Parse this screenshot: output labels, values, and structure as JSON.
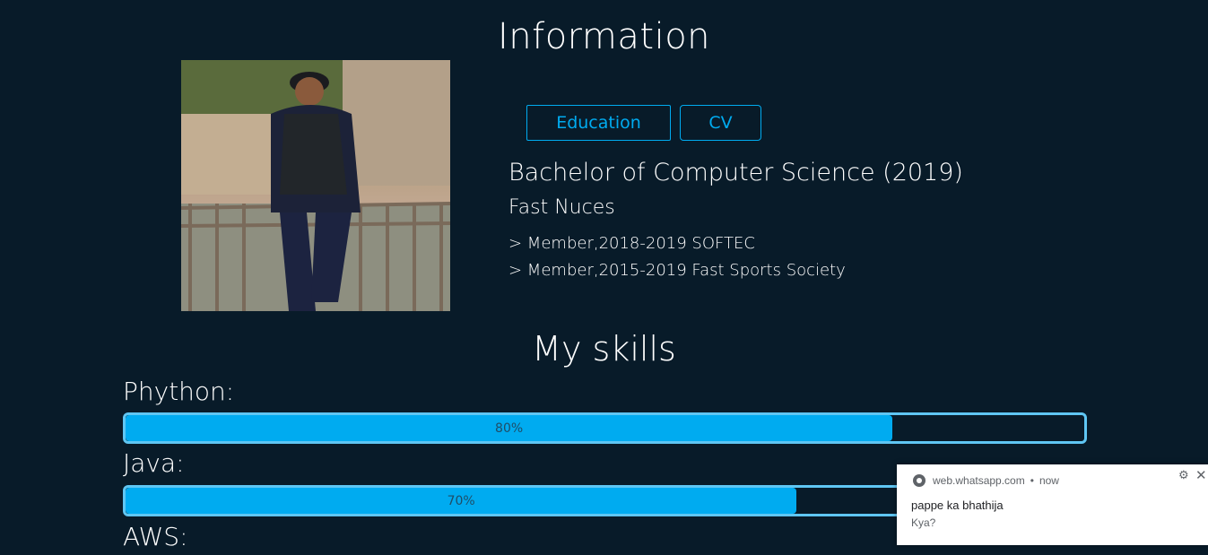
{
  "header": {
    "title": "Information"
  },
  "profile": {
    "photo_alt": "profile-photo"
  },
  "tabs": [
    {
      "label": "Education"
    },
    {
      "label": "CV"
    }
  ],
  "education": {
    "degree": "Bachelor of Computer Science (2019)",
    "school": "Fast Nuces",
    "activities": [
      "> Member,2018-2019 SOFTEC",
      "> Member,2015-2019 Fast Sports Society"
    ]
  },
  "skills": {
    "title": "My skills",
    "items": [
      {
        "label": "Phython:",
        "percent_label": "80%",
        "percent": 80
      },
      {
        "label": "Java:",
        "percent_label": "70%",
        "percent": 70
      },
      {
        "label": "AWS:"
      }
    ]
  },
  "notification": {
    "origin": "web.whatsapp.com",
    "time": "now",
    "title": "pappe ka bhathija",
    "message": "Kya?",
    "icons": {
      "app": "chrome-icon",
      "settings": "gear-icon",
      "close": "close-icon"
    }
  },
  "colors": {
    "background": "#081b29",
    "accent": "#00abf0",
    "bar_border": "#5fc6f3"
  }
}
